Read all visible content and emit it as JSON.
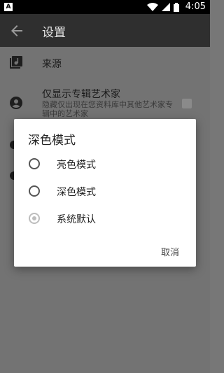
{
  "status_bar": {
    "badge": "A",
    "time": "4:05",
    "icons": [
      "wifi-icon",
      "signal-icon",
      "battery-icon"
    ]
  },
  "app_bar": {
    "title": "设置",
    "back_icon": "arrow-back-icon"
  },
  "settings": {
    "items": [
      {
        "label": "来源",
        "icon": "library-music-icon"
      },
      {
        "label": "仅显示专辑艺术家",
        "subtitle": "隐藏仅出现在您资料库中其他艺术家专辑中的艺术家",
        "icon": "account-circle-icon",
        "checked": true
      }
    ]
  },
  "dialog": {
    "title": "深色模式",
    "options": [
      {
        "label": "亮色模式",
        "selected": false
      },
      {
        "label": "深色模式",
        "selected": false
      },
      {
        "label": "系统默认",
        "selected": true
      }
    ],
    "cancel_label": "取消"
  }
}
